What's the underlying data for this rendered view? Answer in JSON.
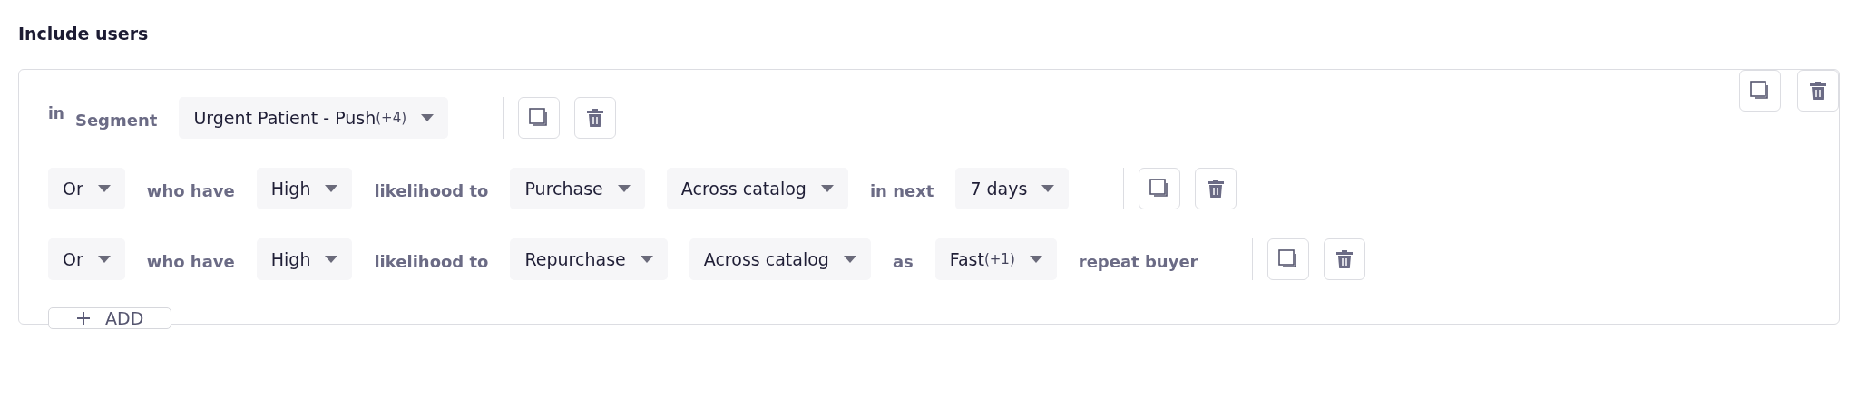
{
  "title": "Include users",
  "rows": [
    {
      "items": [
        {
          "kind": "prefix",
          "text": "in"
        },
        {
          "kind": "text",
          "text": "Segment"
        },
        {
          "kind": "dropdown",
          "label": "Urgent Patient - Push",
          "count": "(+4)"
        }
      ]
    },
    {
      "items": [
        {
          "kind": "dropdown",
          "label": "Or"
        },
        {
          "kind": "text",
          "text": "who have"
        },
        {
          "kind": "dropdown",
          "label": "High"
        },
        {
          "kind": "text",
          "text": "likelihood to"
        },
        {
          "kind": "dropdown",
          "label": "Purchase"
        },
        {
          "kind": "dropdown",
          "label": "Across catalog"
        },
        {
          "kind": "text",
          "text": "in next"
        },
        {
          "kind": "dropdown",
          "label": "7 days"
        }
      ]
    },
    {
      "items": [
        {
          "kind": "dropdown",
          "label": "Or"
        },
        {
          "kind": "text",
          "text": "who have"
        },
        {
          "kind": "dropdown",
          "label": "High"
        },
        {
          "kind": "text",
          "text": "likelihood to"
        },
        {
          "kind": "dropdown",
          "label": "Repurchase"
        },
        {
          "kind": "dropdown",
          "label": "Across catalog"
        },
        {
          "kind": "text",
          "text": "as"
        },
        {
          "kind": "dropdown",
          "label": "Fast",
          "count": "(+1)"
        },
        {
          "kind": "text",
          "text": "repeat buyer"
        }
      ]
    }
  ],
  "add_button": {
    "label": "ADD"
  }
}
